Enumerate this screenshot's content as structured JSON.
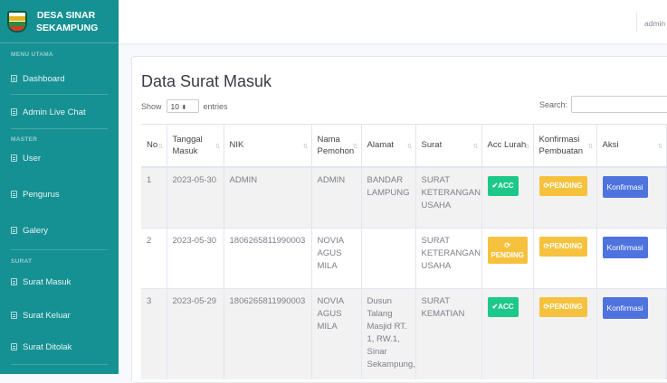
{
  "brand": {
    "line1": "DESA SINAR",
    "line2": "SEKAMPUNG"
  },
  "sidebar": {
    "heading_main": "MENU UTAMA",
    "heading_master": "MASTER",
    "heading_surat": "SURAT",
    "items": [
      {
        "label": "Dashboard"
      },
      {
        "label": "Admin Live Chat"
      },
      {
        "label": "User"
      },
      {
        "label": "Pengurus"
      },
      {
        "label": "Galery"
      },
      {
        "label": "Surat Masuk"
      },
      {
        "label": "Surat Keluar"
      },
      {
        "label": "Surat Ditolak"
      }
    ]
  },
  "topbar": {
    "user": "admin"
  },
  "page": {
    "title": "Data Surat Masuk"
  },
  "length": {
    "show": "Show",
    "value": "10",
    "entries": "entries"
  },
  "search": {
    "label": "Search:"
  },
  "table": {
    "headers": [
      "No",
      "Tanggal Masuk",
      "NIK",
      "Nama Pemohon",
      "Alamat",
      "Surat",
      "Acc Lurah",
      "Konfirmasi Pembuatan",
      "Aksi"
    ],
    "rows": [
      {
        "no": "1",
        "tanggal": "2023-05-30",
        "nik": "ADMIN",
        "nama": "ADMIN",
        "alamat": "BANDAR LAMPUNG",
        "surat": "SURAT KETERANGAN USAHA",
        "acc": "✔ACC",
        "konfirmasi": "⟳PENDING",
        "aksi": "Konfirmasi"
      },
      {
        "no": "2",
        "tanggal": "2023-05-30",
        "nik": "1806265811990003",
        "nama": "NOVIA AGUS MILA",
        "alamat": "",
        "surat": "SURAT KETERANGAN USAHA",
        "acc": "PENDING",
        "acc_icon": "⟳",
        "konfirmasi": "⟳PENDING",
        "aksi": "Konfirmasi"
      },
      {
        "no": "3",
        "tanggal": "2023-05-29",
        "nik": "1806265811990003",
        "nama": "NOVIA AGUS MILA",
        "alamat": "Dusun Talang Masjid RT. 1, RW.1, Sinar Sekampung,",
        "surat": "SURAT KEMATIAN",
        "acc": "✔ACC",
        "konfirmasi": "⟳PENDING",
        "aksi": "Konfirmasi"
      }
    ]
  },
  "colors": {
    "sidebar": "#169193",
    "acc": "#1cc88a",
    "pending": "#f6c23e",
    "button": "#4e73df"
  }
}
